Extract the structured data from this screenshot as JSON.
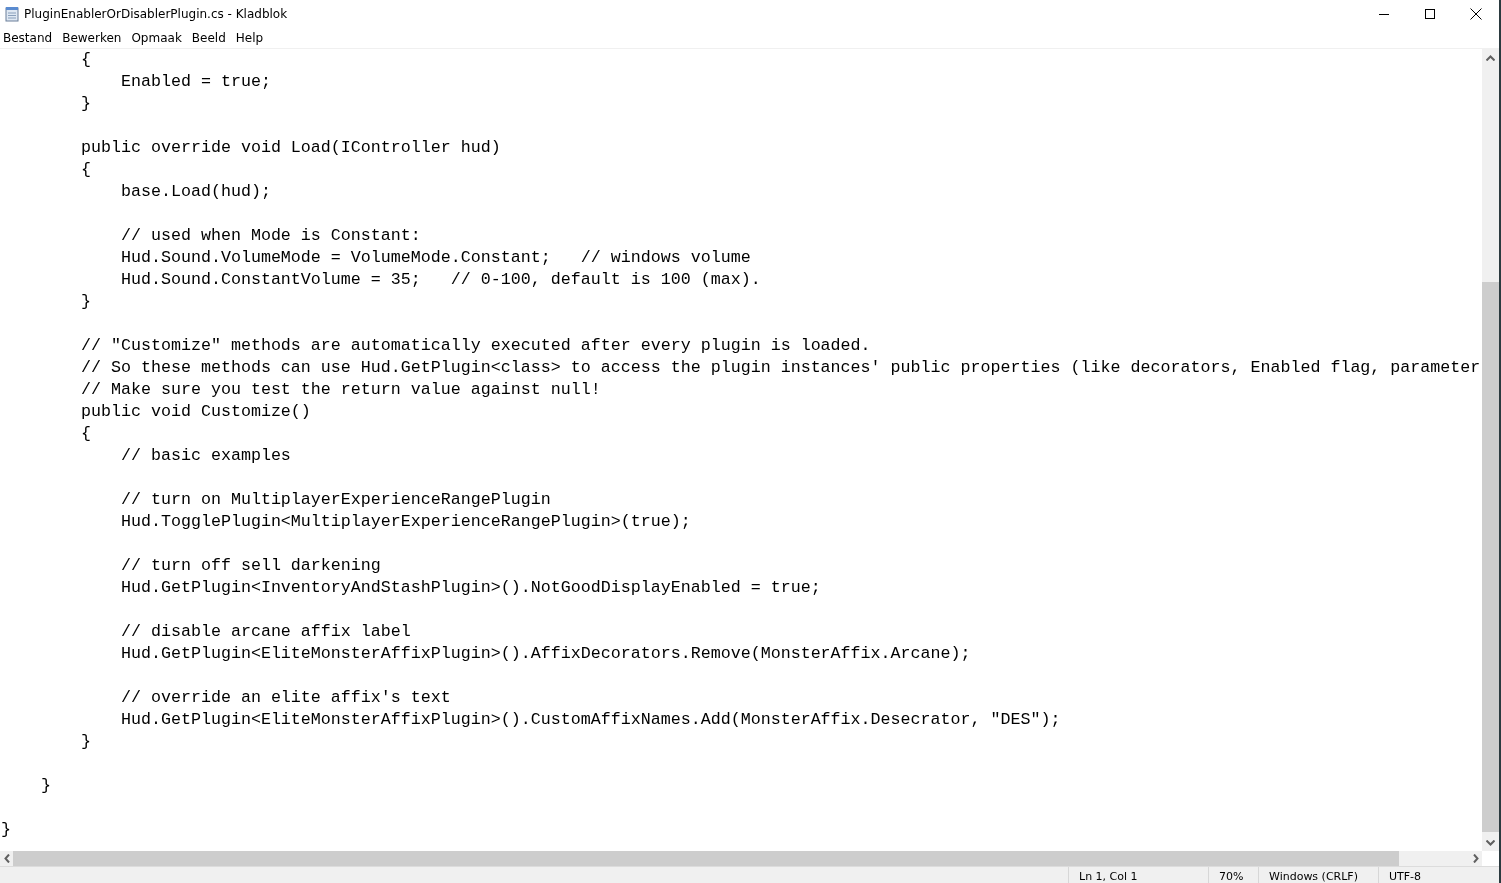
{
  "window": {
    "title": "PluginEnablerOrDisablerPlugin.cs - Kladblok"
  },
  "menu": [
    "Bestand",
    "Bewerken",
    "Opmaak",
    "Beeld",
    "Help"
  ],
  "editor": {
    "blocks": [
      [
        "        {",
        "            Enabled = true;",
        "        }"
      ],
      [
        "        public override void Load(IController hud)",
        "        {",
        "            base.Load(hud);"
      ],
      [
        "            // used when Mode is Constant:",
        "            Hud.Sound.VolumeMode = VolumeMode.Constant;   // windows volume",
        "            Hud.Sound.ConstantVolume = 35;   // 0-100, default is 100 (max).",
        "        }"
      ],
      [
        "        // \"Customize\" methods are automatically executed after every plugin is loaded.",
        "        // So these methods can use Hud.GetPlugin<class> to access the plugin instances' public properties (like decorators, Enabled flag, parameter",
        "        // Make sure you test the return value against null!",
        "        public void Customize()",
        "        {",
        "            // basic examples"
      ],
      [
        "            // turn on MultiplayerExperienceRangePlugin",
        "            Hud.TogglePlugin<MultiplayerExperienceRangePlugin>(true);"
      ],
      [
        "            // turn off sell darkening",
        "            Hud.GetPlugin<InventoryAndStashPlugin>().NotGoodDisplayEnabled = true;"
      ],
      [
        "            // disable arcane affix label",
        "            Hud.GetPlugin<EliteMonsterAffixPlugin>().AffixDecorators.Remove(MonsterAffix.Arcane);"
      ],
      [
        "            // override an elite affix's text",
        "            Hud.GetPlugin<EliteMonsterAffixPlugin>().CustomAffixNames.Add(MonsterAffix.Desecrator, \"DES\");",
        "        }"
      ],
      [
        "    }"
      ],
      [
        "}"
      ]
    ]
  },
  "status_bar": [
    "Ln 1, Col 1",
    "70%",
    "Windows (CRLF)",
    "UTF-8"
  ]
}
